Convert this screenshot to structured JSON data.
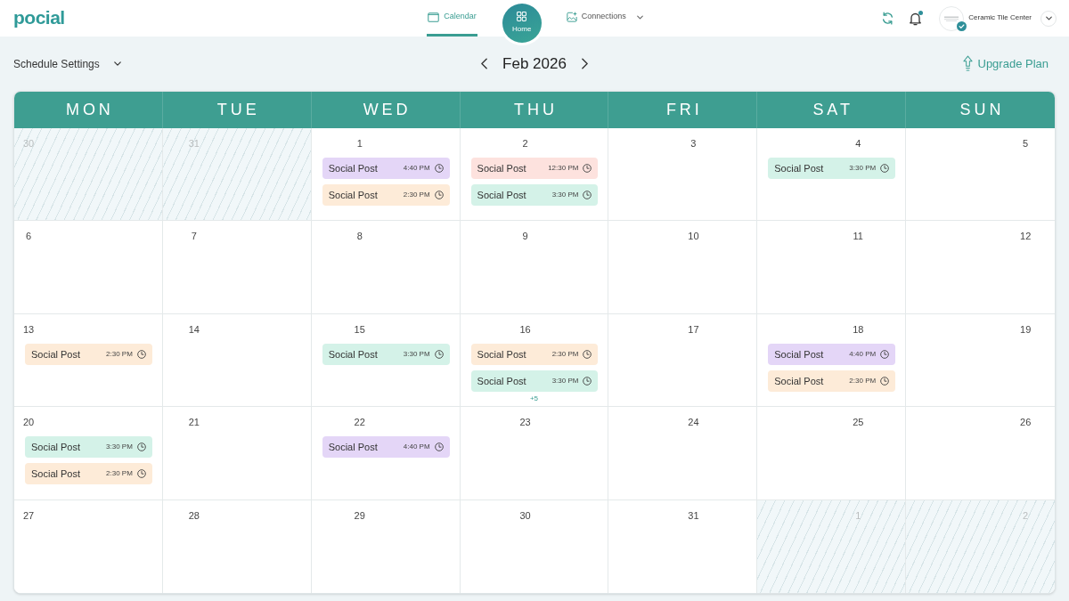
{
  "app": {
    "logo": "pocial"
  },
  "nav": {
    "tabs": [
      {
        "label": "Calendar",
        "kind": "tab",
        "selected": true
      },
      {
        "label": "Home",
        "kind": "circle",
        "selected": false
      },
      {
        "label": "Connections",
        "kind": "dropdown",
        "selected": false
      }
    ]
  },
  "notifications": {
    "unread": true
  },
  "account": {
    "name": "Ceramic Tile Center",
    "verified": true
  },
  "toolbar": {
    "schedule_settings": "Schedule Settings",
    "month": "Feb 2026",
    "upgrade": "Upgrade Plan"
  },
  "calendar": {
    "weekdays": [
      "MON",
      "TUE",
      "WED",
      "THU",
      "FRI",
      "SAT",
      "SUN"
    ],
    "weeks": [
      [
        {
          "day": "30",
          "in_month": false
        },
        {
          "day": "31",
          "in_month": false
        },
        {
          "day": "1",
          "in_month": true,
          "events": [
            {
              "title": "Social Post",
              "time": "4:40 PM",
              "color": "#e4d6f7"
            },
            {
              "title": "Social Post",
              "time": "2:30 PM",
              "color": "#fdebd8"
            }
          ]
        },
        {
          "day": "2",
          "in_month": true,
          "events": [
            {
              "title": "Social Post",
              "time": "12:30 PM",
              "color": "#fde2de"
            },
            {
              "title": "Social Post",
              "time": "3:30 PM",
              "color": "#d4f2e8"
            }
          ]
        },
        {
          "day": "3",
          "in_month": true
        },
        {
          "day": "4",
          "in_month": true,
          "events": [
            {
              "title": "Social Post",
              "time": "3:30 PM",
              "color": "#d4f2e8"
            }
          ]
        },
        {
          "day": "5",
          "in_month": true
        }
      ],
      [
        {
          "day": "6",
          "in_month": true
        },
        {
          "day": "7",
          "in_month": true
        },
        {
          "day": "8",
          "in_month": true
        },
        {
          "day": "9",
          "in_month": true
        },
        {
          "day": "10",
          "in_month": true
        },
        {
          "day": "11",
          "in_month": true
        },
        {
          "day": "12",
          "in_month": true
        }
      ],
      [
        {
          "day": "13",
          "in_month": true,
          "events": [
            {
              "title": "Social Post",
              "time": "2:30 PM",
              "color": "#fdebd8"
            }
          ]
        },
        {
          "day": "14",
          "in_month": true
        },
        {
          "day": "15",
          "in_month": true,
          "events": [
            {
              "title": "Social Post",
              "time": "3:30 PM",
              "color": "#d4f2e8"
            }
          ]
        },
        {
          "day": "16",
          "in_month": true,
          "events": [
            {
              "title": "Social Post",
              "time": "2:30 PM",
              "color": "#fdebd8"
            },
            {
              "title": "Social Post",
              "time": "3:30 PM",
              "color": "#d4f2e8"
            }
          ],
          "more": "+5"
        },
        {
          "day": "17",
          "in_month": true
        },
        {
          "day": "18",
          "in_month": true,
          "events": [
            {
              "title": "Social Post",
              "time": "4:40 PM",
              "color": "#e4d6f7"
            },
            {
              "title": "Social Post",
              "time": "2:30 PM",
              "color": "#fdebd8"
            }
          ]
        },
        {
          "day": "19",
          "in_month": true
        }
      ],
      [
        {
          "day": "20",
          "in_month": true,
          "events": [
            {
              "title": "Social Post",
              "time": "3:30 PM",
              "color": "#d4f2e8"
            },
            {
              "title": "Social Post",
              "time": "2:30 PM",
              "color": "#fdebd8"
            }
          ]
        },
        {
          "day": "21",
          "in_month": true
        },
        {
          "day": "22",
          "in_month": true,
          "events": [
            {
              "title": "Social Post",
              "time": "4:40 PM",
              "color": "#e4d6f7"
            }
          ]
        },
        {
          "day": "23",
          "in_month": true
        },
        {
          "day": "24",
          "in_month": true
        },
        {
          "day": "25",
          "in_month": true
        },
        {
          "day": "26",
          "in_month": true
        }
      ],
      [
        {
          "day": "27",
          "in_month": true
        },
        {
          "day": "28",
          "in_month": true
        },
        {
          "day": "29",
          "in_month": true
        },
        {
          "day": "30",
          "in_month": true
        },
        {
          "day": "31",
          "in_month": true
        },
        {
          "day": "1",
          "in_month": false
        },
        {
          "day": "2",
          "in_month": false
        }
      ]
    ]
  }
}
